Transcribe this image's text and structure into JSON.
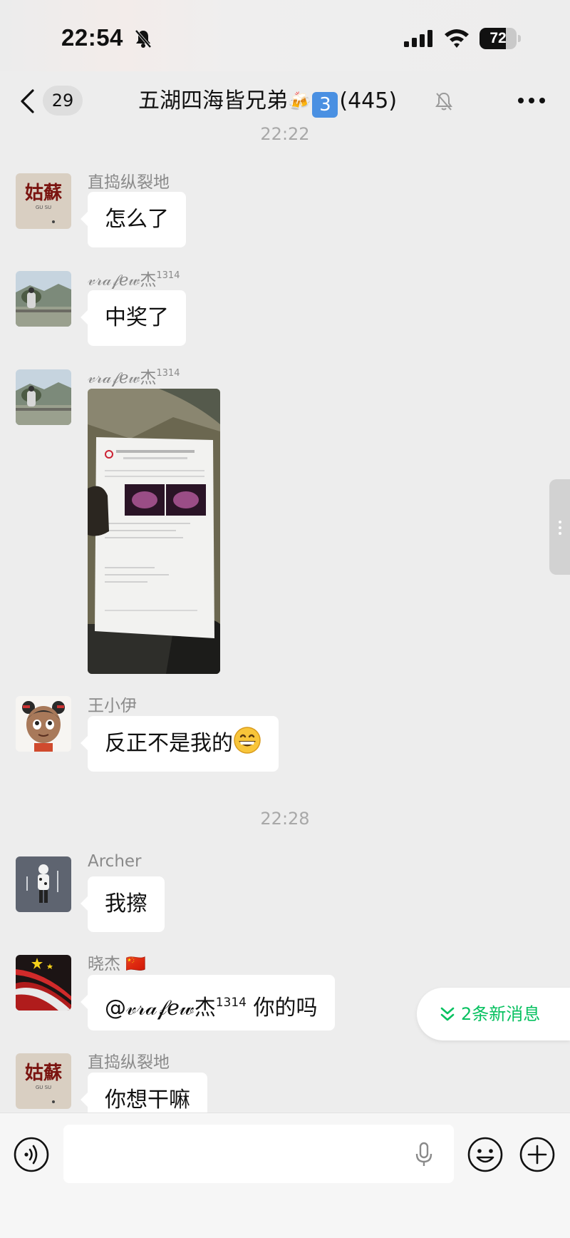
{
  "status_bar": {
    "time": "22:54",
    "battery_level": "72",
    "battery_fraction": 0.72
  },
  "nav": {
    "back_count": "29",
    "title_text": "五湖四海皆兄弟",
    "title_beer_emoji": "🍻",
    "title_keycap": "3",
    "member_count": "(445)"
  },
  "messages": [
    {
      "type": "time",
      "text": "22:22"
    },
    {
      "sender": "直捣纵裂地",
      "avatar": "gusu-avatar",
      "text": "怎么了"
    },
    {
      "sender": "𝓋𝓇𝒶𝒻ℯ𝓌杰",
      "sender_sup": "1314",
      "avatar": "landscape-avatar",
      "text": "中奖了"
    },
    {
      "sender": "𝓋𝓇𝒶𝒻ℯ𝓌杰",
      "sender_sup": "1314",
      "avatar": "landscape-avatar",
      "image": "ultrasound-report-photo"
    },
    {
      "sender": "王小伊",
      "avatar": "cartoon-girl-avatar",
      "text": "反正不是我的"
    },
    {
      "type": "time",
      "text": "22:28"
    },
    {
      "sender": "Archer",
      "avatar": "figure-avatar",
      "text": "我擦"
    },
    {
      "sender": "晓杰",
      "sender_flag": "🇨🇳",
      "avatar": "flag-avatar",
      "text_mention": "@𝓋𝓇𝒶𝒻ℯ𝓌杰",
      "text_mention_sup": "1314",
      "text_rest": " 你的吗"
    },
    {
      "sender": "直捣纵裂地",
      "avatar": "gusu-avatar",
      "text": "你想干嘛"
    }
  ],
  "avatar_text": {
    "gusu": "姑蘇",
    "gusu_sub": "GU SU"
  },
  "new_messages": {
    "label": "2条新消息"
  },
  "input_bar": {
    "placeholder": "",
    "value": ""
  },
  "colors": {
    "background": "#ededed",
    "bubble": "#ffffff",
    "accent_green": "#07c160",
    "timestamp": "#a8a8a8",
    "sender_name": "#8a8a8a"
  },
  "icons": [
    "bell-off-icon",
    "signal-icon",
    "wifi-icon",
    "battery-icon",
    "back-icon",
    "mute-icon",
    "more-icon",
    "voice-icon",
    "mic-icon",
    "emoji-icon",
    "plus-icon",
    "double-chevron-down-icon",
    "grinning-face-emoji"
  ]
}
